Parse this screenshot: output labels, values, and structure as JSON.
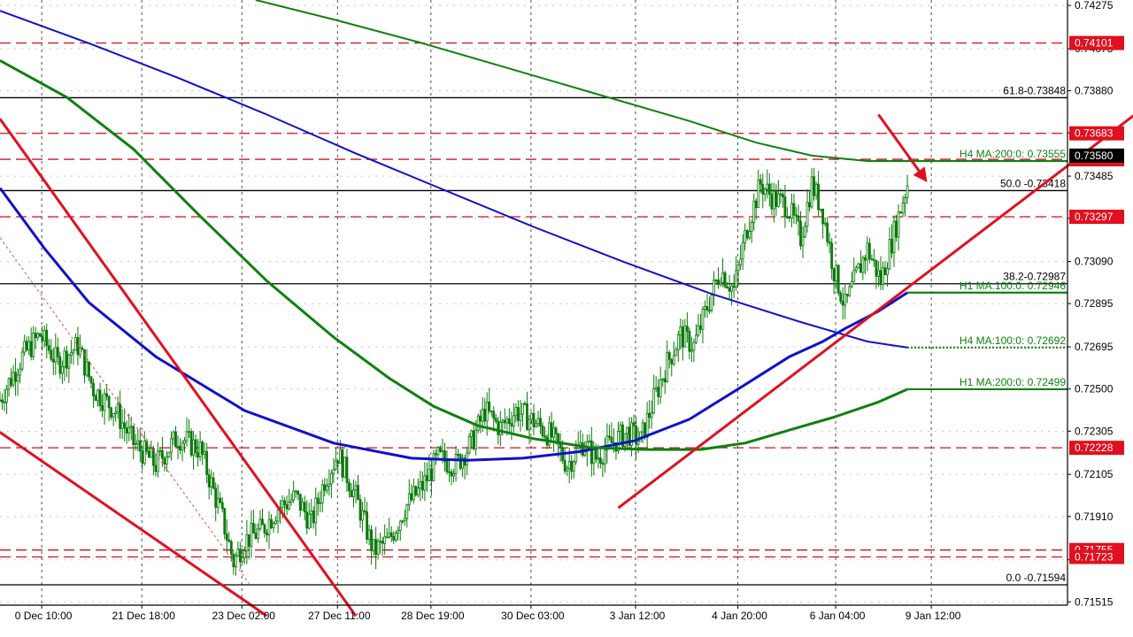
{
  "chart_data": {
    "type": "candlestick",
    "instrument_hint": "",
    "y_range": [
      0.715,
      0.743
    ],
    "price_ticks": [
      "0.74275",
      "0.74075",
      "0.73880",
      "0.73685",
      "0.73485",
      "0.73290",
      "0.73090",
      "0.72895",
      "0.72695",
      "0.72500",
      "0.72305",
      "0.72105",
      "0.71910",
      "0.71710",
      "0.71515"
    ],
    "time_ticks": [
      {
        "label": "0 Dec 10:00",
        "bar": 10
      },
      {
        "label": "21 Dec 18:00",
        "bar": 55
      },
      {
        "label": "23 Dec 02:00",
        "bar": 100
      },
      {
        "label": "27 Dec 11:00",
        "bar": 143
      },
      {
        "label": "28 Dec 19:00",
        "bar": 185
      },
      {
        "label": "30 Dec 03:00",
        "bar": 230
      },
      {
        "label": "3 Jan 12:00",
        "bar": 277
      },
      {
        "label": "4 Jan 20:00",
        "bar": 323
      },
      {
        "label": "6 Jan 04:00",
        "bar": 367
      },
      {
        "label": "9 Jan 12:00",
        "bar": 410
      }
    ],
    "bars_total": 480,
    "last_bar": 408,
    "grid": true,
    "red_levels": [
      {
        "price": 0.74101,
        "badge": "0.74101"
      },
      {
        "price": 0.73683,
        "badge": "0.73683"
      },
      {
        "price": 0.73563,
        "badge": "0.73563"
      },
      {
        "price": 0.73297,
        "badge": "0.73297"
      },
      {
        "price": 0.72228,
        "badge": "0.72228"
      },
      {
        "price": 0.71755,
        "badge": "0.71755"
      },
      {
        "price": 0.71723,
        "badge": "0.71723"
      }
    ],
    "fib_levels": [
      {
        "price": 0.73848,
        "label": "61.8-0.73848"
      },
      {
        "price": 0.73418,
        "label": "50.0 -0.73418"
      },
      {
        "price": 0.72987,
        "label": "38.2-0.72987"
      },
      {
        "price": 0.71594,
        "label": "0.0 -0.71594"
      }
    ],
    "ma_labels": [
      {
        "price": 0.73555,
        "label": "H4 MA:200:0: 0.73555",
        "start_bar": 390,
        "style": "solid"
      },
      {
        "price": 0.72946,
        "label": "H1 MA:100:0: 0.72946",
        "start_bar": 408,
        "style": "solid"
      },
      {
        "price": 0.72692,
        "label": "H4 MA:100:0: 0.72692",
        "start_bar": 408,
        "style": "dotted"
      },
      {
        "price": 0.72499,
        "label": "H1 MA:200:0: 0.72499",
        "start_bar": 408,
        "style": "solid"
      }
    ],
    "current_price_badge": "0.73580",
    "series": [
      {
        "id": "h1-ma100",
        "color": "#1010cc",
        "points": [
          [
            0,
            0.7343
          ],
          [
            20,
            0.7315
          ],
          [
            40,
            0.729
          ],
          [
            70,
            0.7265
          ],
          [
            110,
            0.724
          ],
          [
            150,
            0.7225
          ],
          [
            185,
            0.7218
          ],
          [
            210,
            0.7217
          ],
          [
            235,
            0.7218
          ],
          [
            260,
            0.7221
          ],
          [
            285,
            0.7226
          ],
          [
            310,
            0.7236
          ],
          [
            335,
            0.7252
          ],
          [
            355,
            0.7265
          ],
          [
            370,
            0.7272
          ],
          [
            380,
            0.7278
          ],
          [
            395,
            0.7286
          ],
          [
            408,
            0.72946
          ]
        ]
      },
      {
        "id": "h1-ma200",
        "color": "#108010",
        "points": [
          [
            0,
            0.7402
          ],
          [
            30,
            0.7385
          ],
          [
            60,
            0.7361
          ],
          [
            90,
            0.733
          ],
          [
            120,
            0.73
          ],
          [
            150,
            0.7274
          ],
          [
            175,
            0.7255
          ],
          [
            195,
            0.7242
          ],
          [
            215,
            0.7233
          ],
          [
            240,
            0.7227
          ],
          [
            265,
            0.7223
          ],
          [
            290,
            0.7222
          ],
          [
            315,
            0.7222
          ],
          [
            335,
            0.7225
          ],
          [
            355,
            0.7231
          ],
          [
            375,
            0.7237
          ],
          [
            395,
            0.7244
          ],
          [
            408,
            0.72499
          ]
        ]
      },
      {
        "id": "h4-ma100",
        "color": "#1010cc",
        "points": [
          [
            0,
            0.7425
          ],
          [
            40,
            0.741
          ],
          [
            80,
            0.7394
          ],
          [
            120,
            0.7377
          ],
          [
            160,
            0.7359
          ],
          [
            200,
            0.7342
          ],
          [
            240,
            0.7325
          ],
          [
            280,
            0.7309
          ],
          [
            320,
            0.7294
          ],
          [
            360,
            0.7281
          ],
          [
            390,
            0.7272
          ],
          [
            408,
            0.72692
          ]
        ]
      },
      {
        "id": "h4-ma200",
        "color": "#108010",
        "points": [
          [
            115,
            0.743
          ],
          [
            150,
            0.7421
          ],
          [
            190,
            0.741
          ],
          [
            230,
            0.7398
          ],
          [
            270,
            0.7386
          ],
          [
            310,
            0.7374
          ],
          [
            340,
            0.7364
          ],
          [
            365,
            0.7358
          ],
          [
            390,
            0.73555
          ]
        ]
      }
    ],
    "trendlines": [
      {
        "color": "#e01020",
        "points": [
          [
            0,
            0.7375
          ],
          [
            160,
            0.7145
          ]
        ]
      },
      {
        "color": "#e01020",
        "points": [
          [
            0,
            0.723
          ],
          [
            120,
            0.7145
          ]
        ]
      },
      {
        "color": "#e01020",
        "points": [
          [
            278,
            0.7195
          ],
          [
            578,
            0.743
          ]
        ]
      },
      {
        "color": "#e05060",
        "dash": true,
        "points": [
          [
            0,
            0.732
          ],
          [
            112,
            0.716
          ]
        ]
      }
    ],
    "arrow": {
      "color": "#e01020",
      "from": [
        395,
        0.7377
      ],
      "to": [
        416,
        0.7347
      ]
    },
    "price_path": [
      [
        0,
        0.7245
      ],
      [
        10,
        0.7265
      ],
      [
        18,
        0.7275
      ],
      [
        26,
        0.7262
      ],
      [
        35,
        0.727
      ],
      [
        42,
        0.725
      ],
      [
        52,
        0.724
      ],
      [
        60,
        0.7225
      ],
      [
        70,
        0.7215
      ],
      [
        80,
        0.7228
      ],
      [
        90,
        0.7222
      ],
      [
        100,
        0.719
      ],
      [
        105,
        0.717
      ],
      [
        110,
        0.718
      ],
      [
        118,
        0.7185
      ],
      [
        125,
        0.7195
      ],
      [
        133,
        0.72
      ],
      [
        140,
        0.7188
      ],
      [
        146,
        0.7208
      ],
      [
        152,
        0.722
      ],
      [
        160,
        0.72
      ],
      [
        168,
        0.7175
      ],
      [
        175,
        0.718
      ],
      [
        182,
        0.7195
      ],
      [
        190,
        0.7205
      ],
      [
        197,
        0.7218
      ],
      [
        205,
        0.7215
      ],
      [
        212,
        0.7225
      ],
      [
        218,
        0.724
      ],
      [
        225,
        0.7232
      ],
      [
        232,
        0.724
      ],
      [
        240,
        0.7235
      ],
      [
        248,
        0.7228
      ],
      [
        255,
        0.7215
      ],
      [
        262,
        0.7225
      ],
      [
        268,
        0.7218
      ],
      [
        275,
        0.7225
      ],
      [
        282,
        0.723
      ],
      [
        288,
        0.7226
      ],
      [
        294,
        0.7245
      ],
      [
        300,
        0.7262
      ],
      [
        306,
        0.7275
      ],
      [
        312,
        0.727
      ],
      [
        318,
        0.7288
      ],
      [
        324,
        0.7305
      ],
      [
        330,
        0.7296
      ],
      [
        336,
        0.7325
      ],
      [
        342,
        0.7345
      ],
      [
        348,
        0.7338
      ],
      [
        354,
        0.7335
      ],
      [
        360,
        0.732
      ],
      [
        365,
        0.7345
      ],
      [
        370,
        0.7332
      ],
      [
        375,
        0.7305
      ],
      [
        380,
        0.7288
      ],
      [
        385,
        0.7302
      ],
      [
        390,
        0.7315
      ],
      [
        396,
        0.73
      ],
      [
        400,
        0.7315
      ],
      [
        404,
        0.733
      ],
      [
        408,
        0.7345
      ],
      [
        412,
        0.7358
      ]
    ]
  }
}
